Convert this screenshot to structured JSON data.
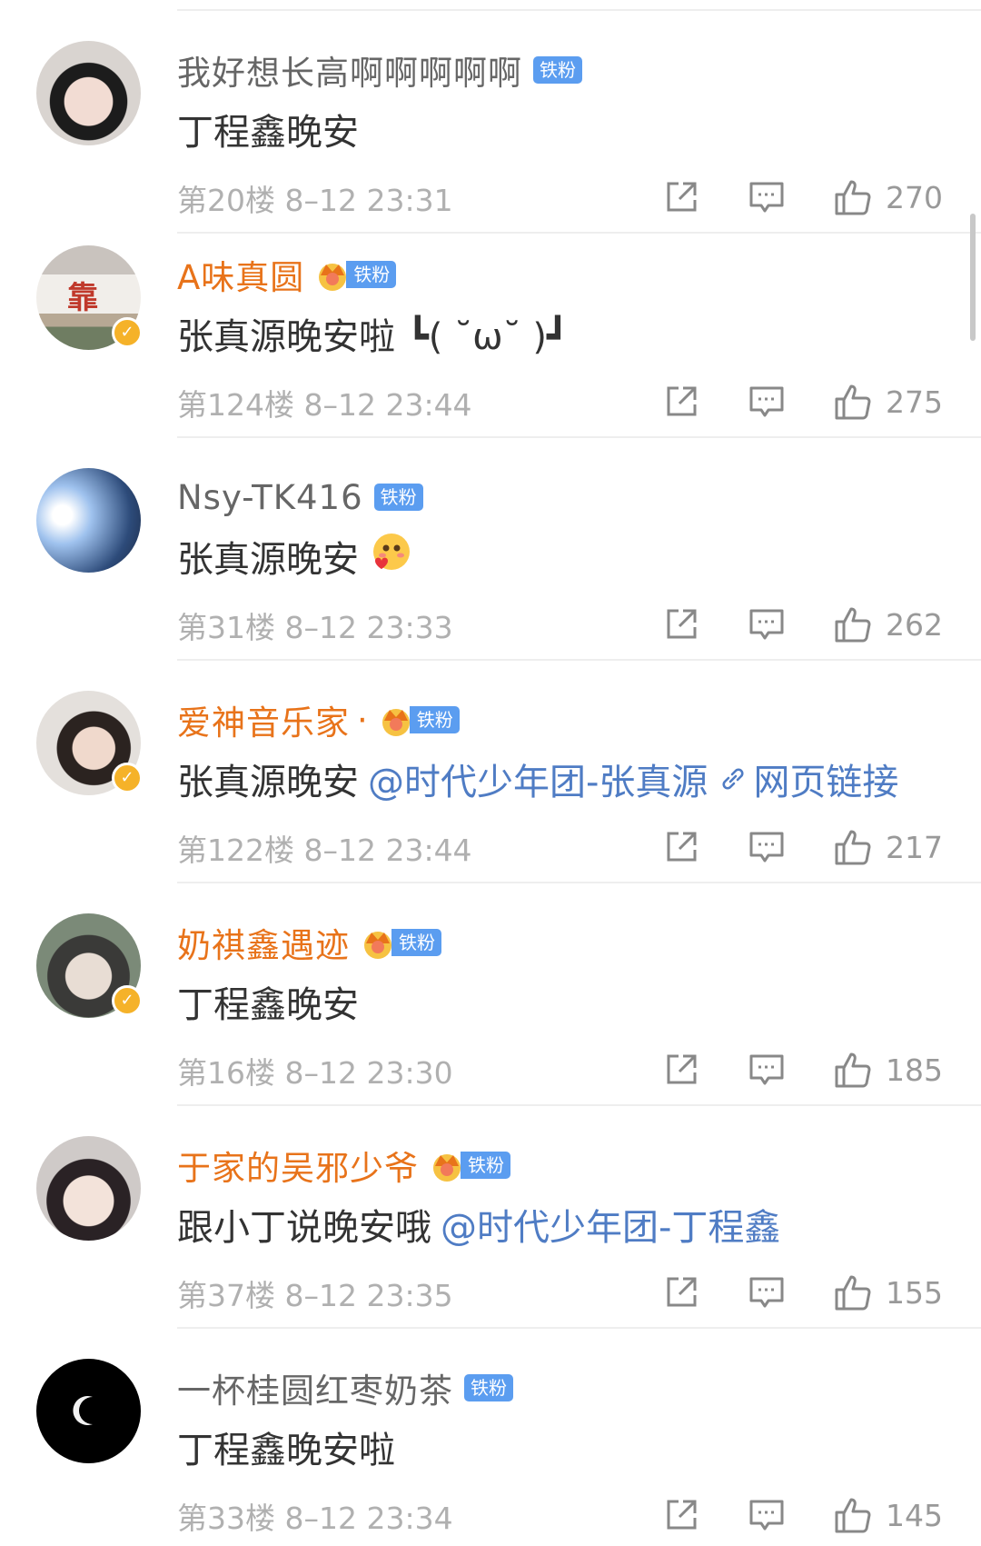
{
  "colors": {
    "username_orange": "#e8731a",
    "username_gray": "#666666",
    "mention_blue": "#4f7cc4",
    "fan_badge_blue": "#5b9df0",
    "verified_gold": "#f5b229",
    "meta_gray": "#b0b0b0"
  },
  "comments": [
    {
      "username": "我好想长高啊啊啊啊啊",
      "name_dot": "",
      "vip": false,
      "verified": false,
      "fan_badge": "铁粉",
      "text": "丁程鑫晚安",
      "emoji": "",
      "mention": "",
      "link": "",
      "floor_time": "第20楼 8–12 23:31",
      "likes": "270",
      "avatar_icon": "person-avatar"
    },
    {
      "username": "A味真圆",
      "name_dot": "",
      "vip": true,
      "verified": true,
      "fan_badge": "铁粉",
      "text": "张真源晚安啦 ┗( ˘ω˘ )┛",
      "emoji": "",
      "mention": "",
      "link": "",
      "floor_time": "第124楼 8–12 23:44",
      "likes": "275",
      "avatar_char": "靠"
    },
    {
      "username": "Nsy-TK416",
      "name_dot": "",
      "vip": false,
      "verified": false,
      "fan_badge": "铁粉",
      "text": "张真源晚安",
      "emoji": "blush-heart-emoji",
      "mention": "",
      "link": "",
      "floor_time": "第31楼 8–12 23:33",
      "likes": "262"
    },
    {
      "username": "爱神音乐家",
      "name_dot": "·",
      "vip": true,
      "verified": true,
      "fan_badge": "铁粉",
      "text": "张真源晚安",
      "emoji": "",
      "mention": "@时代少年团-张真源",
      "link": "网页链接",
      "floor_time": "第122楼 8–12 23:44",
      "likes": "217"
    },
    {
      "username": "奶祺鑫遇迹",
      "name_dot": "",
      "vip": true,
      "verified": true,
      "fan_badge": "铁粉",
      "text": "丁程鑫晚安",
      "emoji": "",
      "mention": "",
      "link": "",
      "floor_time": "第16楼 8–12 23:30",
      "likes": "185"
    },
    {
      "username": "于家的吴邪少爷",
      "name_dot": "",
      "vip": true,
      "verified": false,
      "fan_badge": "铁粉",
      "text": "跟小丁说晚安哦",
      "emoji": "",
      "mention": "@时代少年团-丁程鑫",
      "link": "",
      "floor_time": "第37楼 8–12 23:35",
      "likes": "155"
    },
    {
      "username": "一杯桂圆红枣奶茶",
      "name_dot": "",
      "vip": false,
      "verified": false,
      "fan_badge": "铁粉",
      "text": "丁程鑫晚安啦",
      "emoji": "",
      "mention": "",
      "link": "",
      "floor_time": "第33楼 8–12 23:34",
      "likes": "145"
    }
  ]
}
